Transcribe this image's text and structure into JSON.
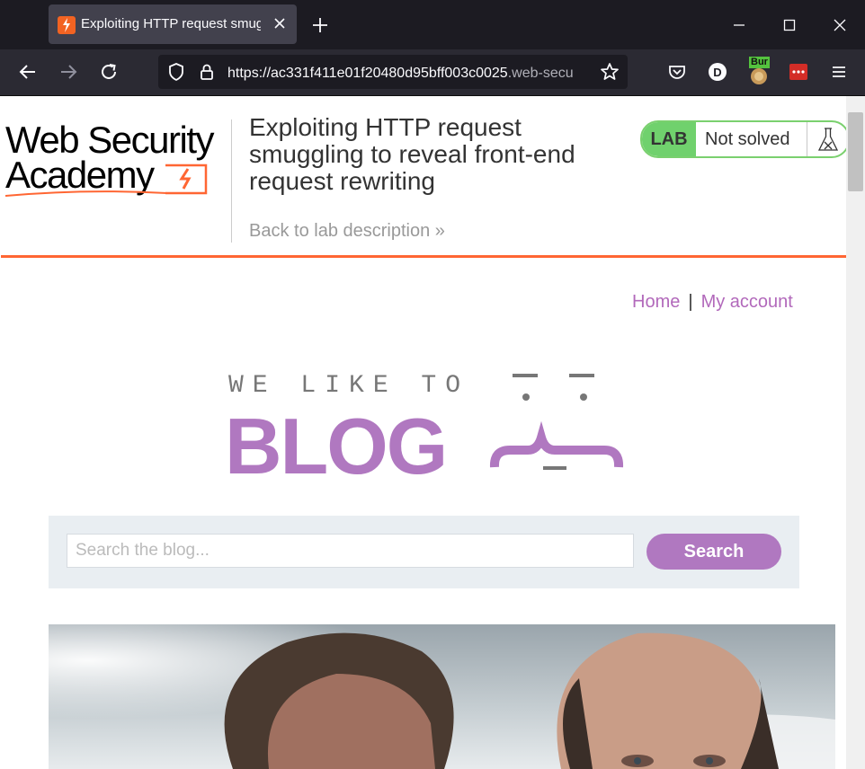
{
  "browser": {
    "tab": {
      "title": "Exploiting HTTP request smuggl",
      "favicon": "portswigger-bolt-icon"
    },
    "url": {
      "main": "https://ac331f411e01f20480d95bff003c0025",
      "tail": ".web-secu"
    },
    "extension_badge": "Bur"
  },
  "academy": {
    "logo": {
      "line1": "Web Security",
      "line2": "Academy"
    },
    "lab_title": "Exploiting HTTP request smuggling to reveal front-end request rewriting",
    "back_link": "Back to lab description",
    "back_chevron": "»",
    "lab_badge": {
      "label": "LAB",
      "status": "Not solved"
    }
  },
  "site": {
    "nav": {
      "home": "Home",
      "separator": "|",
      "account": "My account"
    },
    "banner": {
      "tagline": "WE LIKE TO",
      "word": "BLOG"
    },
    "search": {
      "placeholder": "Search the blog...",
      "button": "Search"
    }
  },
  "colors": {
    "accent": "#b078c0",
    "brand_orange": "#ff6633",
    "lab_green": "#70d16d",
    "chrome_dark": "#1c1b22"
  }
}
